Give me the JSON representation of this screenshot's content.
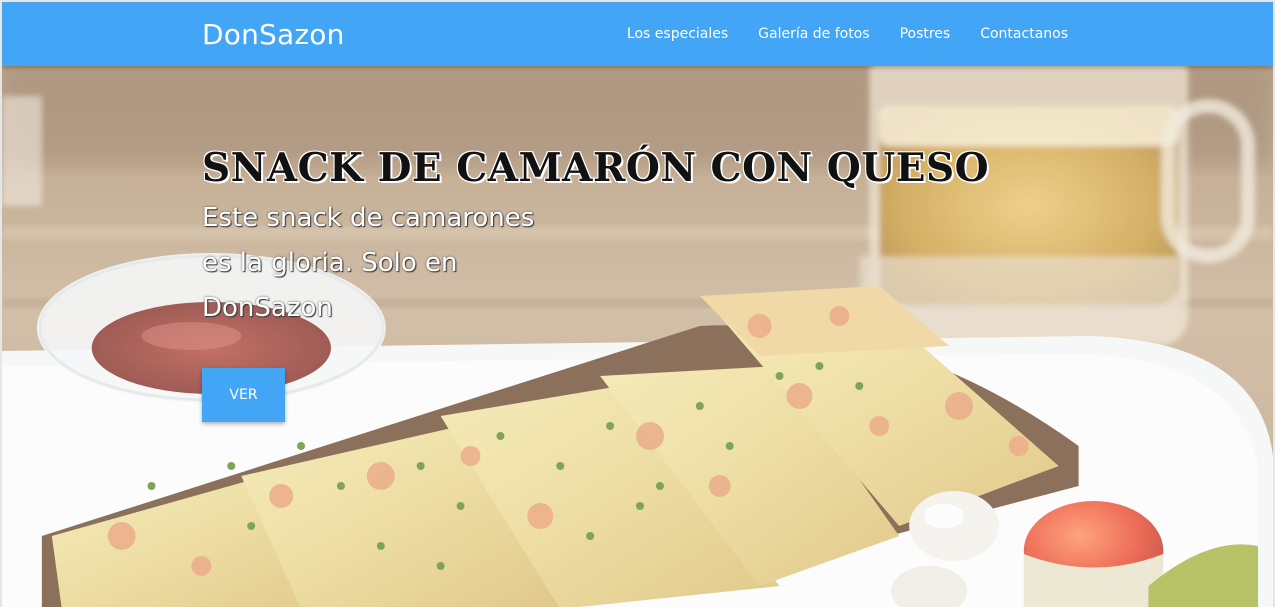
{
  "colors": {
    "navbar": "#42a5f5",
    "button": "#42a5f5",
    "nav_text": "#ffffff",
    "title_text": "#111111"
  },
  "navbar": {
    "brand": "DonSazon",
    "links": [
      {
        "label": "Los especiales"
      },
      {
        "label": "Galería de fotos"
      },
      {
        "label": "Postres"
      },
      {
        "label": "Contactanos"
      }
    ]
  },
  "hero": {
    "background_image": "food-photo",
    "title": "SNACK DE CAMARÓN CON QUESO",
    "text": "Este snack de camarones es la gloria. Solo en DonSazon",
    "button_label": "VER"
  }
}
